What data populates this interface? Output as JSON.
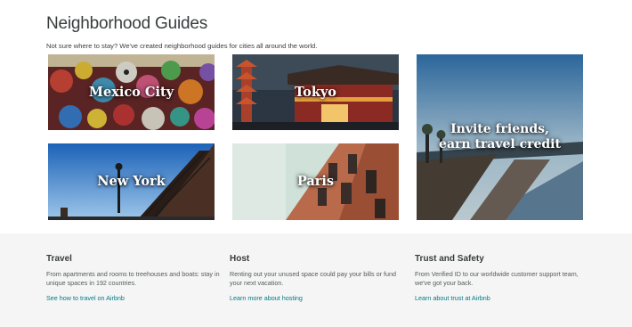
{
  "header": {
    "title": "Neighborhood Guides",
    "subtitle": "Not sure where to stay? We've created neighborhood guides for cities all around the world."
  },
  "tiles": [
    {
      "label": "Mexico City"
    },
    {
      "label": "Tokyo"
    },
    {
      "label": "New York"
    },
    {
      "label": "Paris"
    },
    {
      "label_line1": "Invite friends,",
      "label_line2": "earn travel credit"
    }
  ],
  "footer": {
    "columns": [
      {
        "title": "Travel",
        "text": "From apartments and rooms to treehouses and boats: stay in unique spaces in 192 countries.",
        "link": "See how to travel on Airbnb"
      },
      {
        "title": "Host",
        "text": "Renting out your unused space could pay your bills or fund your next vacation.",
        "link": "Learn more about hosting"
      },
      {
        "title": "Trust and Safety",
        "text": "From Verified ID to our worldwide customer support team, we've got your back.",
        "link": "Learn about trust at Airbnb"
      }
    ]
  },
  "colors": {
    "link": "#007a87",
    "text": "#393c3d",
    "band": "#f5f5f5"
  }
}
